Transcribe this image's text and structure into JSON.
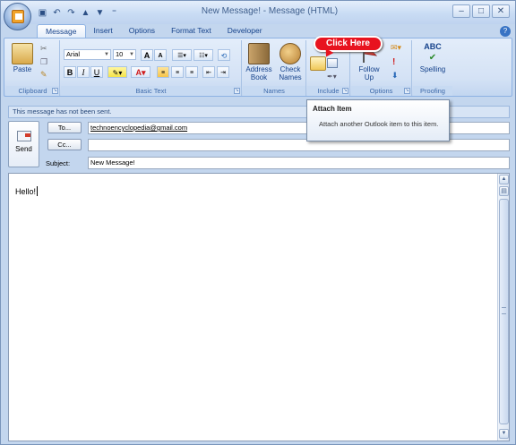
{
  "window": {
    "title": "New Message! - Message (HTML)",
    "controls": {
      "minimize": "–",
      "maximize": "□",
      "close": "✕"
    }
  },
  "quick_access": {
    "icons": [
      "save-icon",
      "undo-icon",
      "redo-icon",
      "previous-icon",
      "next-icon",
      "customize-icon"
    ]
  },
  "tabs": [
    {
      "label": "Message",
      "active": true
    },
    {
      "label": "Insert"
    },
    {
      "label": "Options"
    },
    {
      "label": "Format Text"
    },
    {
      "label": "Developer"
    }
  ],
  "ribbon": {
    "clipboard": {
      "label": "Clipboard",
      "paste": "Paste"
    },
    "basic_text": {
      "label": "Basic Text",
      "font": "Arial",
      "size": "10",
      "bold": "B",
      "italic": "I",
      "underline": "U",
      "grow": "A",
      "shrink": "A"
    },
    "names": {
      "label": "Names",
      "address_book": [
        "Address",
        "Book"
      ],
      "check_names": [
        "Check",
        "Names"
      ]
    },
    "include": {
      "label": "Include"
    },
    "options": {
      "label": "Options",
      "follow_up": [
        "Follow",
        "Up"
      ]
    },
    "proofing": {
      "label": "Proofing",
      "spelling": "Spelling",
      "abc": "ABC"
    }
  },
  "callout": {
    "text": "Click Here"
  },
  "tooltip": {
    "title": "Attach Item",
    "description": "Attach another Outlook item to this item."
  },
  "info_bar": "This message has not been sent.",
  "header": {
    "send": "Send",
    "to_button": "To...",
    "cc_button": "Cc...",
    "subject_label": "Subject:",
    "to_value": "technoencyclopedia@gmail.com",
    "cc_value": "",
    "subject_value": "New Message!"
  },
  "body": {
    "text": "Hello!"
  },
  "colors": {
    "accent": "#15428b",
    "callout": "#e8131f",
    "ribbon": "#d4e2f5"
  }
}
